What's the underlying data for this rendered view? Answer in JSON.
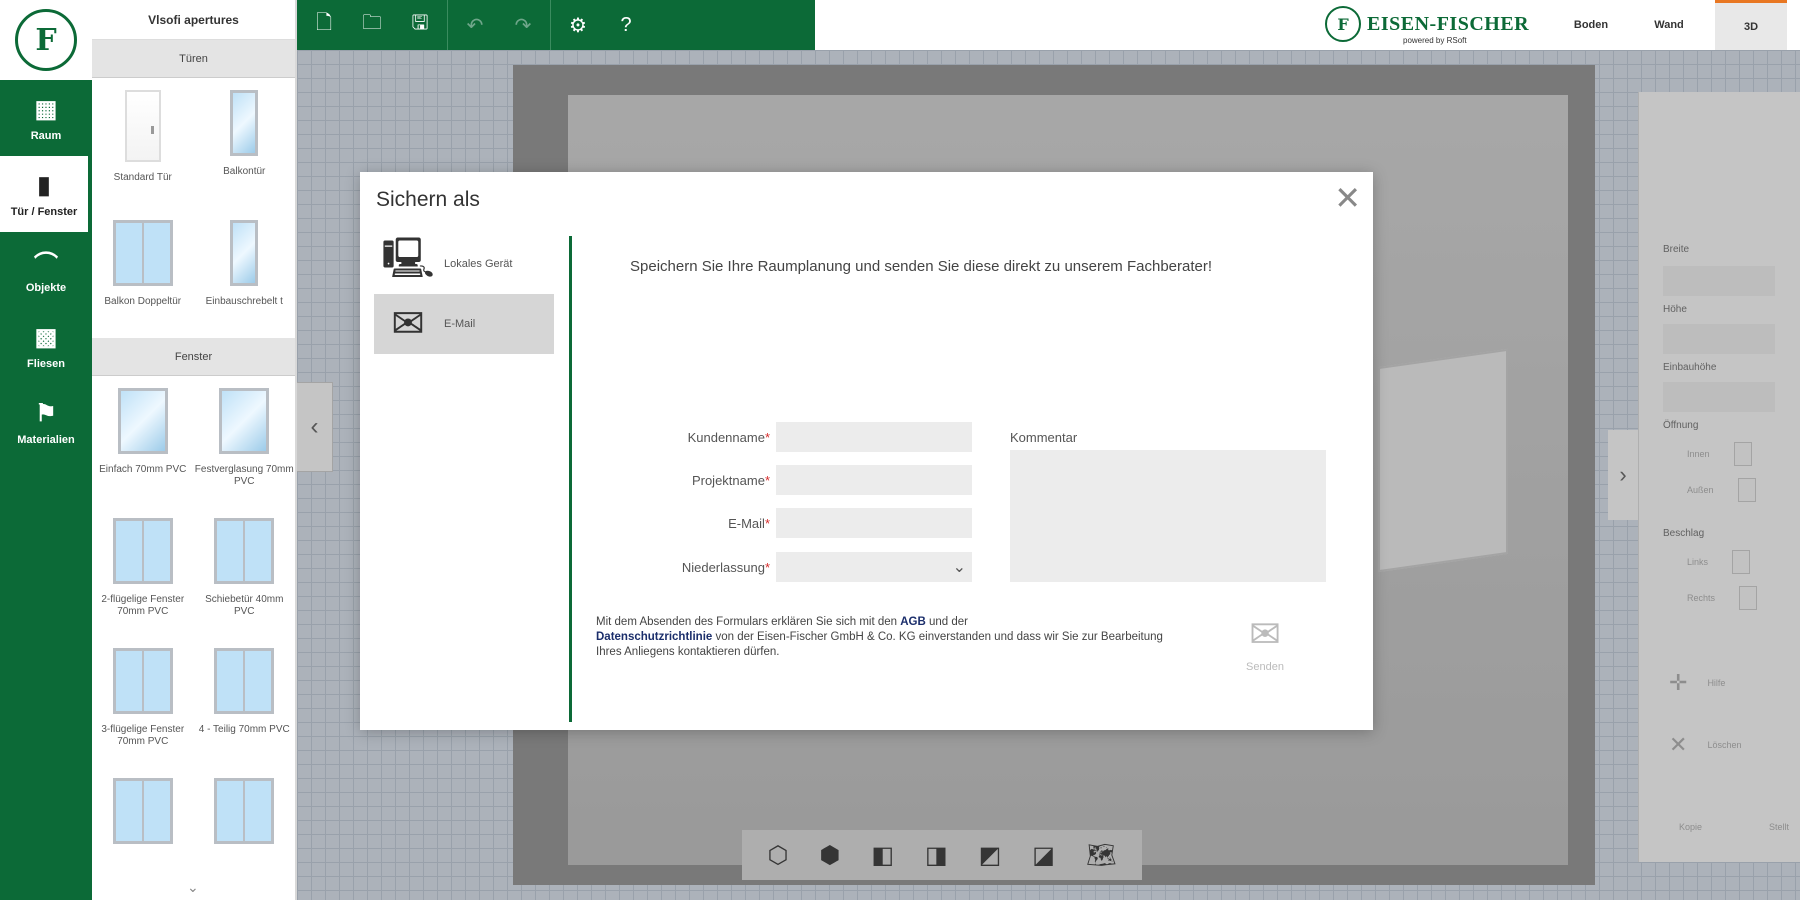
{
  "nav": {
    "items": [
      {
        "label": "Raum",
        "icon": "room-icon"
      },
      {
        "label": "Tür / Fenster",
        "icon": "door-icon"
      },
      {
        "label": "Objekte",
        "icon": "objects-icon"
      },
      {
        "label": "Fliesen",
        "icon": "tiles-icon"
      },
      {
        "label": "Materialien",
        "icon": "materials-icon"
      }
    ]
  },
  "catalog": {
    "title": "Vlsofi apertures",
    "sections": [
      {
        "name": "Türen",
        "items": [
          "Standard Tür",
          "Balkontür",
          "Balkon Doppeltür",
          "Einbauschrebelt t"
        ]
      },
      {
        "name": "Fenster",
        "items": [
          "Einfach 70mm PVC",
          "Festverglasung 70mm PVC",
          "2-flügelige Fenster 70mm PVC",
          "Schiebetür 40mm PVC",
          "3-flügelige Fenster 70mm PVC",
          "4 - Teilig 70mm PVC",
          "",
          ""
        ]
      }
    ]
  },
  "header": {
    "brand_name": "EISEN-FISCHER",
    "brand_sub": "powered by RSoft",
    "view_tabs": [
      "Boden",
      "Wand",
      "3D"
    ]
  },
  "modal": {
    "title": "Sichern als",
    "close": "✕",
    "options": [
      {
        "label": "Lokales Gerät"
      },
      {
        "label": "E-Mail"
      }
    ],
    "heading": "Speichern Sie Ihre Raumplanung und senden Sie diese direkt zu unserem Fachberater!",
    "fields": {
      "kundenname": "Kundenname",
      "projektname": "Projektname",
      "email": "E-Mail",
      "niederlassung": "Niederlassung",
      "required_mark": "*"
    },
    "comment_label": "Kommentar",
    "legal": {
      "part1": "Mit dem Absenden des Formulars erklären Sie sich mit den ",
      "agb": "AGB",
      "part2": " und der ",
      "privacy": "Datenschutzrichtlinie",
      "part3": " von der Eisen-Fischer GmbH & Co. KG einverstanden und dass wir Sie zur Bearbeitung Ihres Anliegens kontaktieren dürfen."
    },
    "send_label": "Senden"
  },
  "props": {
    "labels": [
      "Breite",
      "Höhe",
      "Einbauhöhe",
      "Öffnung",
      "Beschlag"
    ],
    "opening": [
      "Innen",
      "Außen"
    ],
    "fitting": [
      "Links",
      "Rechts"
    ],
    "actions": [
      "Hilfe",
      "Löschen"
    ],
    "bottom": [
      "Kopie",
      "Stellt"
    ]
  },
  "colors": {
    "brand_green": "#0c6a37",
    "accent_orange": "#e87722",
    "link_navy": "#1b2e6b"
  }
}
